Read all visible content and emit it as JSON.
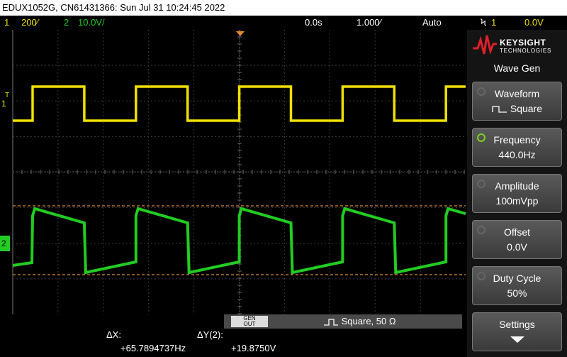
{
  "title_bar": {
    "text": "EDUX1052G, CN61431366: Sun Jul 31 10:24:45 2022"
  },
  "status_bar": {
    "ch1_num": "1",
    "ch1_scale": "200⁄",
    "ch2_num": "2",
    "ch2_scale": "10.0V/",
    "time_offset": "0.0s",
    "time_scale": "1.000⁄",
    "trigger_mode": "Auto",
    "trigger_icon": "Ϟ",
    "trigger_channel": "1",
    "trigger_level": "0.0V"
  },
  "plot": {
    "trigger_marker": "T",
    "ch1_marker": "1",
    "ch2_marker": "2"
  },
  "logo": {
    "line1": "KEYSIGHT",
    "line2": "TECHNOLOGIES"
  },
  "panel": {
    "title": "Wave Gen",
    "softkeys": [
      {
        "label": "Waveform",
        "value": "Square"
      },
      {
        "label": "Frequency",
        "value": "440.0Hz"
      },
      {
        "label": "Amplitude",
        "value": "100mVpp"
      },
      {
        "label": "Offset",
        "value": "0.0V"
      },
      {
        "label": "Duty Cycle",
        "value": "50%"
      },
      {
        "label": "Settings",
        "value": ""
      }
    ]
  },
  "gen_bar": {
    "button_line1": "GEN",
    "button_line2": "OUT",
    "text": "Square, 50 Ω"
  },
  "measurements": {
    "dx_label": "ΔX:",
    "dx_value": "+65.7894737Hz",
    "dy_label": "ΔY(2):",
    "dy_value": "+19.8750V"
  },
  "colors": {
    "ch1": "#f0e000",
    "ch2": "#22cc22",
    "cursor": "#e08a30",
    "accent": "#7cd41e"
  }
}
